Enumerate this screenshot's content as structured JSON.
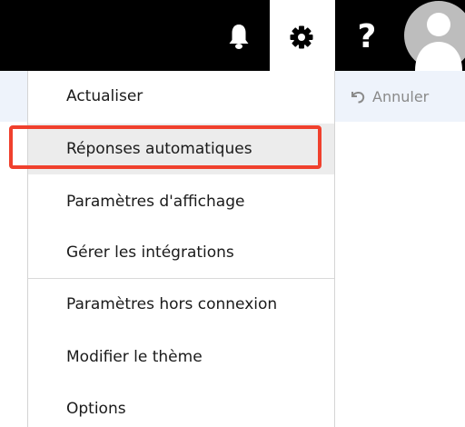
{
  "topbar": {
    "background": "#000000",
    "bell_icon": "bell-icon",
    "gear_icon": "gear-icon",
    "help_label": "?",
    "avatar_icon": "user-avatar-icon"
  },
  "command_bar": {
    "background": "#eef3fb",
    "undo_label": "Annuler",
    "undo_icon": "undo-icon"
  },
  "menu": {
    "items": [
      {
        "label": "Actualiser"
      },
      {
        "label": "Réponses automatiques"
      },
      {
        "label": "Paramètres d'affichage"
      },
      {
        "label": "Gérer les intégrations"
      },
      {
        "label": "Paramètres hors connexion"
      },
      {
        "label": "Modifier le thème"
      },
      {
        "label": "Options"
      }
    ],
    "highlighted_index": 1,
    "highlight_color": "#f0402d"
  }
}
